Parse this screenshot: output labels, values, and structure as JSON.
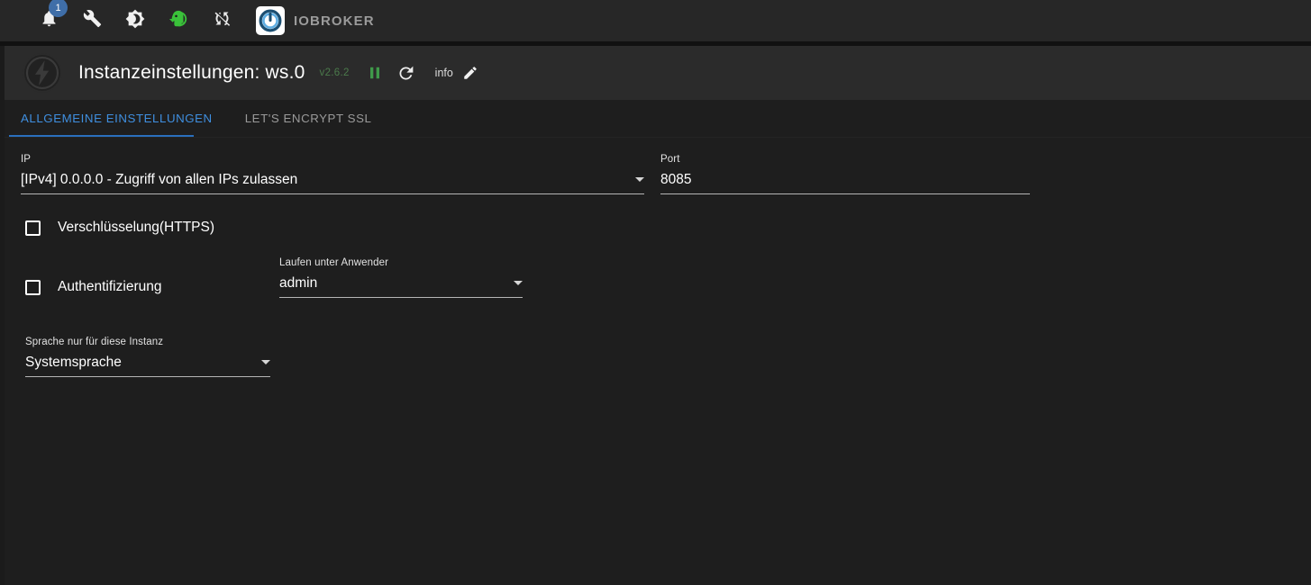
{
  "appbar": {
    "icons": [
      {
        "name": "notifications-icon",
        "label": "bell"
      },
      {
        "name": "wrench-icon",
        "label": "wrench"
      },
      {
        "name": "brightness-icon",
        "label": "brightness"
      },
      {
        "name": "expert-mode-icon",
        "label": "expert head"
      },
      {
        "name": "sync-off-icon",
        "label": "sync disabled"
      }
    ],
    "badge_count": "1",
    "brand": "IOBROKER",
    "badge_color": "#3f6ea8",
    "expert_color": "#3ac13a"
  },
  "titlebar": {
    "instance_icon": "lightning-bolt-icon",
    "title": "Instanzeinstellungen: ws.0",
    "version": "v2.6.2",
    "version_color": "#4b7a4b",
    "pause_label": "pause",
    "pause_color": "#3f9a4a",
    "refresh_label": "restart",
    "info_label": "info",
    "edit_label": "edit"
  },
  "tabs": [
    {
      "label": "ALLGEMEINE EINSTELLUNGEN",
      "active": true
    },
    {
      "label": "LET'S ENCRYPT SSL",
      "active": false
    }
  ],
  "tab_accent": "#3f8fe0",
  "form": {
    "ip": {
      "label": "IP",
      "value": "[IPv4] 0.0.0.0 - Zugriff von allen IPs zulassen"
    },
    "port": {
      "label": "Port",
      "value": "8085"
    },
    "https": {
      "label": "Verschlüsselung(HTTPS)",
      "checked": false
    },
    "auth": {
      "label": "Authentifizierung",
      "checked": false
    },
    "run_as_user": {
      "label": "Laufen unter Anwender",
      "value": "admin"
    },
    "language": {
      "label": "Sprache nur für diese Instanz",
      "value": "Systemsprache"
    }
  }
}
